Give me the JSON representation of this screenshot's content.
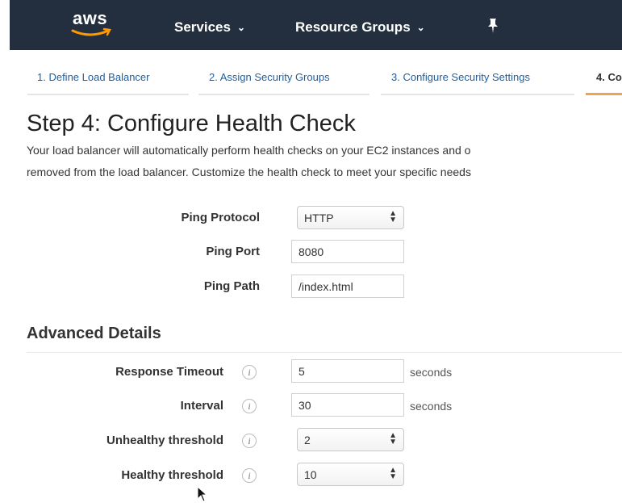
{
  "header": {
    "logo_text": "aws",
    "nav": [
      {
        "label": "Services"
      },
      {
        "label": "Resource Groups"
      }
    ]
  },
  "wizard": {
    "steps": [
      {
        "label": "1. Define Load Balancer"
      },
      {
        "label": "2. Assign Security Groups"
      },
      {
        "label": "3. Configure Security Settings"
      },
      {
        "label": "4. Co"
      }
    ],
    "active_step": 4
  },
  "page": {
    "title": "Step 4: Configure Health Check",
    "description_line1": "Your load balancer will automatically perform health checks on your EC2 instances and o",
    "description_line2": "removed from the load balancer. Customize the health check to meet your specific needs"
  },
  "health_check": {
    "ping_protocol": {
      "label": "Ping Protocol",
      "value": "HTTP"
    },
    "ping_port": {
      "label": "Ping Port",
      "value": "8080"
    },
    "ping_path": {
      "label": "Ping Path",
      "value": "/index.html"
    }
  },
  "advanced": {
    "title": "Advanced Details",
    "response_timeout": {
      "label": "Response Timeout",
      "value": "5",
      "unit": "seconds"
    },
    "interval": {
      "label": "Interval",
      "value": "30",
      "unit": "seconds"
    },
    "unhealthy_threshold": {
      "label": "Unhealthy threshold",
      "value": "2"
    },
    "healthy_threshold": {
      "label": "Healthy threshold",
      "value": "10"
    },
    "info_glyph": "i"
  },
  "colors": {
    "topbar": "#232f3e",
    "link": "#1f5f9f",
    "active_tab": "#f0a24c"
  }
}
